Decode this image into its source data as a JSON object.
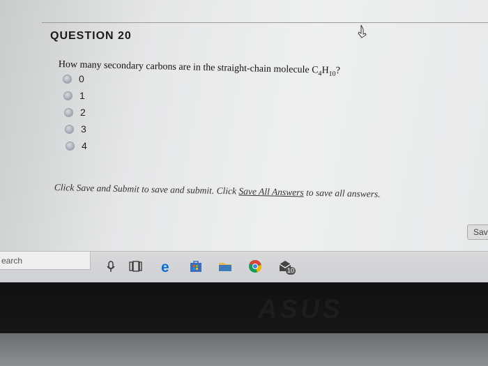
{
  "question": {
    "title": "QUESTION 20",
    "text_prefix": "How many secondary carbons are in the straight-chain molecule C",
    "sub1": "4",
    "text_mid": "H",
    "sub2": "10",
    "text_suffix": "?"
  },
  "options": [
    "0",
    "1",
    "2",
    "3",
    "4"
  ],
  "instructions": {
    "part1": "Click Save and Submit to save and submit. Click ",
    "link": "Save All Answers",
    "part2": " to save all answers."
  },
  "save_button_label": "Sav",
  "taskbar": {
    "search_text": "earch",
    "mail_badge": "10"
  },
  "laptop_logo": "ASUS",
  "colors": {
    "edge_blue": "#0a6fd6",
    "chrome_red": "#db4437",
    "chrome_yellow": "#f4b400",
    "chrome_green": "#0f9d58"
  }
}
